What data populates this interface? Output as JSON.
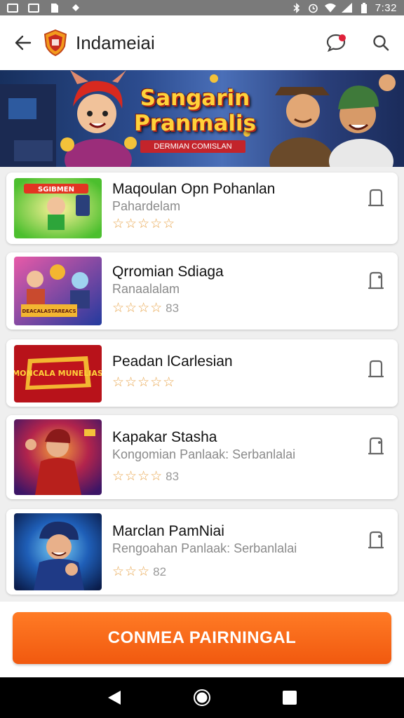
{
  "status_bar": {
    "time": "7:32",
    "icons": [
      "image-icon",
      "gallery-icon",
      "file-icon",
      "dot-icon",
      "bluetooth-icon",
      "alarm-icon",
      "wifi-icon",
      "signal-icon",
      "battery-icon"
    ]
  },
  "app_bar": {
    "title": "Indameiai",
    "icons": [
      "back-arrow-icon",
      "shield-logo-icon",
      "chat-bubble-icon",
      "search-icon"
    ]
  },
  "banner": {
    "title_line1": "Sangarin",
    "title_line2": "Pranmalis",
    "tagline": "DERMIAN COMISLAN"
  },
  "games": [
    {
      "title": "Maqoulan Opn Pohanlan",
      "subtitle": "Pahardelam",
      "stars": "☆☆☆☆☆",
      "count": "",
      "thumb_text": "SGIBMEN",
      "thumb_colors": [
        "#f7d21a",
        "#3fbf2e"
      ]
    },
    {
      "title": "Qrromian Sdiaga",
      "subtitle": "Ranaalalam",
      "stars": "☆☆☆☆",
      "count": "83",
      "thumb_text": "DEACALASTAREACS",
      "thumb_colors": [
        "#2f3c9e",
        "#c94a7e"
      ]
    },
    {
      "title": "Peadan lCarlesian",
      "subtitle": "",
      "stars": "☆☆☆☆☆",
      "count": "",
      "thumb_text": "MONCALA MUNELIAS",
      "thumb_colors": [
        "#c0141c",
        "#f3b631"
      ]
    },
    {
      "title": "Kapakar Stasha",
      "subtitle": "Kongomian Panlaak: Serbanlalai",
      "stars": "☆☆☆☆",
      "count": "83",
      "thumb_text": "",
      "thumb_colors": [
        "#4a1d6a",
        "#e03a31"
      ]
    },
    {
      "title": "Marclan PamNiai",
      "subtitle": "Rengoahan Panlaak: Serbanlalai",
      "stars": "☆☆☆",
      "count": "82",
      "thumb_text": "",
      "thumb_colors": [
        "#0e3a8c",
        "#35a7e8"
      ]
    }
  ],
  "cta": {
    "label": "CONMEA PAIRNINGAL"
  },
  "colors": {
    "accent": "#f1590f",
    "star": "#e8a64e",
    "status_bar": "#7a7a7a"
  },
  "nav": {
    "icons": [
      "back-triangle-icon",
      "home-circle-icon",
      "recents-square-icon"
    ]
  }
}
